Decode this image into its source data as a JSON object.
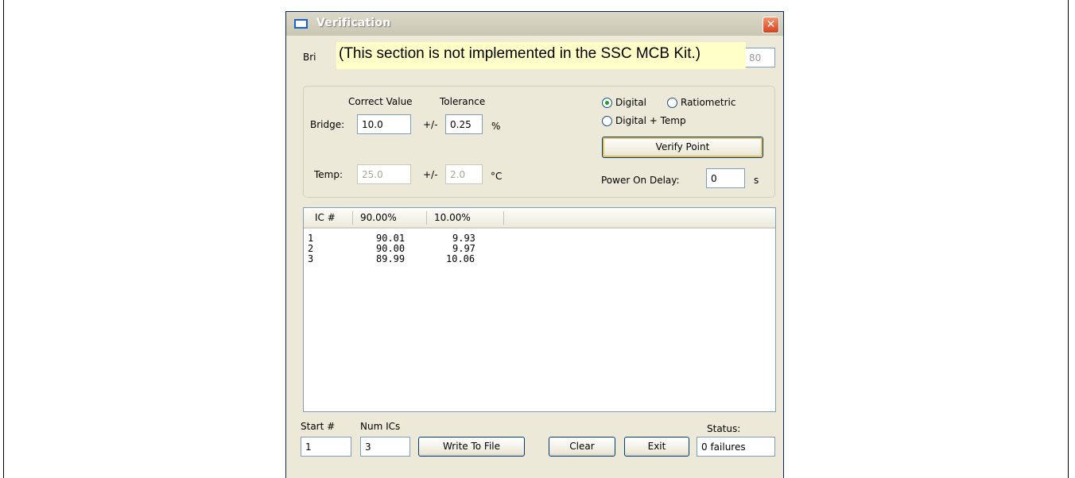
{
  "window": {
    "title": "Verification",
    "close_label": "✕"
  },
  "notice": "(This section is not implemented in the SSC MCB Kit.)",
  "hidden_row": {
    "label_prefix": "Bri",
    "field_tail": "80"
  },
  "setpoint": {
    "correct_value_header": "Correct Value",
    "tolerance_header": "Tolerance",
    "bridge_label": "Bridge:",
    "bridge_value": "10.0",
    "bridge_pm": "+/-",
    "bridge_tolerance": "0.25",
    "bridge_unit": "%",
    "temp_label": "Temp:",
    "temp_value": "25.0",
    "temp_pm": "+/-",
    "temp_tolerance": "2.0",
    "temp_unit": "°C"
  },
  "mode": {
    "options": [
      {
        "label": "Digital",
        "checked": true
      },
      {
        "label": "Ratiometric",
        "checked": false
      },
      {
        "label": "Digital + Temp",
        "checked": false
      }
    ],
    "verify_button": "Verify Point",
    "power_delay_label": "Power On Delay:",
    "power_delay_value": "0",
    "power_delay_unit": "s"
  },
  "results": {
    "columns": [
      "IC #",
      "90.00%",
      "10.00%"
    ],
    "rows": [
      [
        "1",
        "90.01",
        "9.93"
      ],
      [
        "2",
        "90.00",
        "9.97"
      ],
      [
        "3",
        "89.99",
        "10.06"
      ]
    ]
  },
  "footer": {
    "start_label": "Start #",
    "start_value": "1",
    "num_ics_label": "Num ICs",
    "num_ics_value": "3",
    "write_button": "Write To File",
    "clear_button": "Clear",
    "exit_button": "Exit",
    "status_label": "Status:",
    "status_value": "0 failures"
  }
}
